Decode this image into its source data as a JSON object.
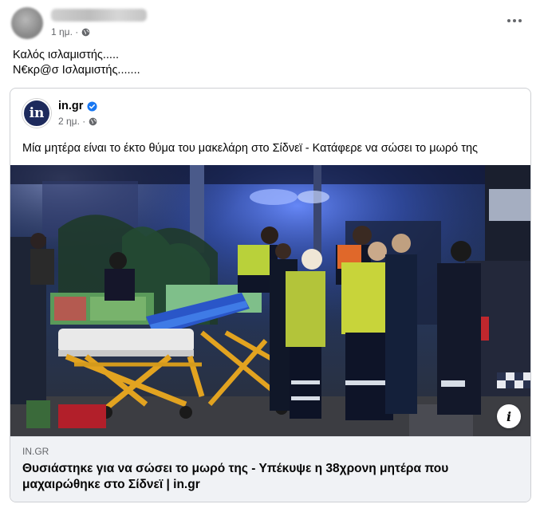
{
  "post": {
    "timestamp": "1 ημ. ·",
    "text_line1": "Καλός ισλαμιστής.....",
    "text_line2": "Ν€κρ@σ Ισλαμιστής.......",
    "icons": {
      "privacy": "globe-icon",
      "menu": "more-options-icon"
    }
  },
  "shared": {
    "logo_text": "in",
    "page_name": "in.gr",
    "timestamp": "2 ημ. ·",
    "text": "Μία μητέρα είναι το έκτο θύμα του μακελάρη στο Σίδνεϊ - Κατάφερε να σώσει το μωρό της",
    "icons": {
      "verified": "verified-badge-icon",
      "info": "info-icon"
    },
    "accent": "#1877f2",
    "logo_color": "#1d2a5c"
  },
  "link": {
    "domain": "IN.GR",
    "title": "Θυσιάστηκε για να σώσει το μωρό της - Υπέκυψε η 38χρονη μητέρα που μαχαιρώθηκε στο Σίδνεϊ | in.gr",
    "info_glyph": "i"
  }
}
